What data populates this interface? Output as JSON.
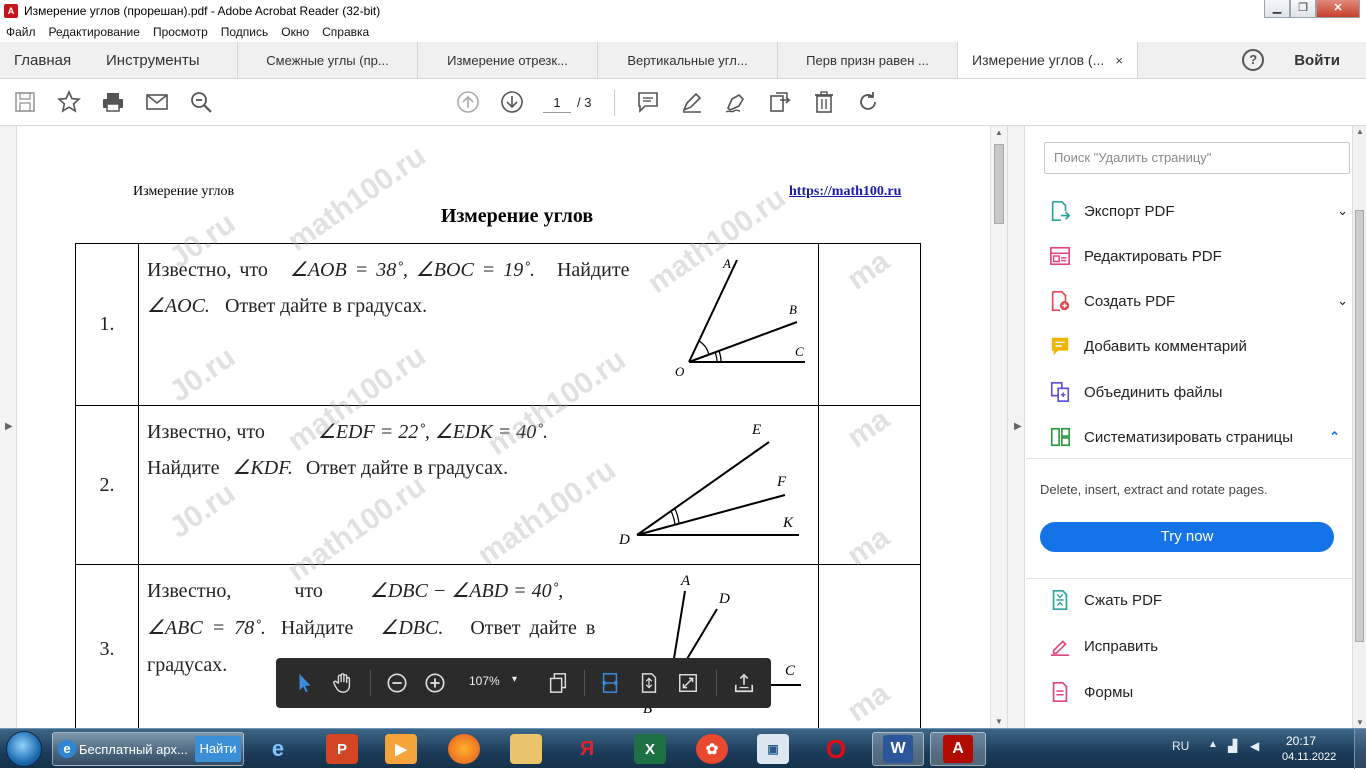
{
  "window": {
    "title": "Измерение углов (прорешан).pdf - Adobe Acrobat Reader (32-bit)",
    "app_icon": "A",
    "controls": [
      "minimize",
      "maximize",
      "close"
    ]
  },
  "menu": [
    "Файл",
    "Редактирование",
    "Просмотр",
    "Подпись",
    "Окно",
    "Справка"
  ],
  "tabs": {
    "home": "Главная",
    "tools": "Инструменты",
    "documents": [
      "Смежные углы (пр...",
      "Измерение отрезк...",
      "Вертикальные угл...",
      "Перв призн равен ..."
    ],
    "active": "Измерение углов (...",
    "close_glyph": "×",
    "help_glyph": "?",
    "signin": "Войти"
  },
  "toolbar": {
    "page_current": "1",
    "page_total": "/ 3"
  },
  "document": {
    "header_left": "Измерение углов",
    "header_right": "https://math100.ru",
    "title": "Измерение углов",
    "watermark_text": "math100.ru",
    "watermark_short": "J0.ru",
    "watermark_mark": "ma",
    "rows": [
      {
        "num": "1.",
        "line1_a": "Известно, что",
        "line1_math": "∠AOB = 38˚, ∠BOC = 19˚.",
        "line1_b": "Найдите",
        "line2_math": "∠AOC.",
        "line2_b": "Ответ дайте в градусах.",
        "fig_labels": [
          "A",
          "B",
          "C",
          "O"
        ]
      },
      {
        "num": "2.",
        "line1_a": "Известно, что",
        "line1_math": "∠EDF = 22˚, ∠EDK = 40˚.",
        "line2_a": "Найдите",
        "line2_math": "∠KDF.",
        "line2_b": "Ответ дайте в градусах.",
        "fig_labels": [
          "E",
          "F",
          "K",
          "D"
        ]
      },
      {
        "num": "3.",
        "line1_a": "Известно, что",
        "line1_math": "∠DBC − ∠ABD = 40˚,",
        "line2_math": "∠ABC = 78˚.",
        "line2_b": "Найдите",
        "line2_math2": "∠DBC.",
        "line2_c": "Ответ дайте в",
        "line3": "градусах.",
        "fig_labels": [
          "A",
          "D",
          "C",
          "B"
        ]
      }
    ]
  },
  "floating_toolbar": {
    "zoom": "107%",
    "zoom_caret": "▾"
  },
  "right_panel": {
    "search_placeholder": "Поиск \"Удалить страницу\"",
    "items": [
      {
        "label": "Экспорт PDF",
        "icon": "export-pdf-icon",
        "color": "#2aa39a",
        "chevron": "⌄"
      },
      {
        "label": "Редактировать PDF",
        "icon": "edit-pdf-icon",
        "color": "#e0457b",
        "chevron": ""
      },
      {
        "label": "Создать PDF",
        "icon": "create-pdf-icon",
        "color": "#e34850",
        "chevron": "⌄"
      },
      {
        "label": "Добавить комментарий",
        "icon": "comment-icon",
        "color": "#f0b400",
        "chevron": ""
      },
      {
        "label": "Объединить файлы",
        "icon": "combine-files-icon",
        "color": "#5b50d6",
        "chevron": ""
      },
      {
        "label": "Систематизировать страницы",
        "icon": "organize-pages-icon",
        "color": "#2b9a3f",
        "chevron": "⌃"
      }
    ],
    "description": "Delete, insert, extract and rotate pages.",
    "try_now": "Try now",
    "more_items": [
      {
        "label": "Сжать PDF",
        "icon": "compress-pdf-icon",
        "color": "#2aa39a"
      },
      {
        "label": "Исправить",
        "icon": "fill-sign-icon",
        "color": "#e0457b"
      },
      {
        "label": "Формы",
        "icon": "forms-icon",
        "color": "#e0457b"
      }
    ]
  },
  "taskbar": {
    "ie_label": "Бесплатный арх...",
    "ie_go": "Найти",
    "lang": "RU",
    "time": "20:17",
    "date": "04.11.2022",
    "apps": [
      "ie-icon",
      "explorer-icon",
      "powerpoint-icon",
      "media-icon",
      "firefox-icon",
      "folder-icon",
      "yandex-icon",
      "excel-icon",
      "rutube-icon",
      "app-icon",
      "opera-icon",
      "word-icon",
      "acrobat-icon"
    ]
  }
}
